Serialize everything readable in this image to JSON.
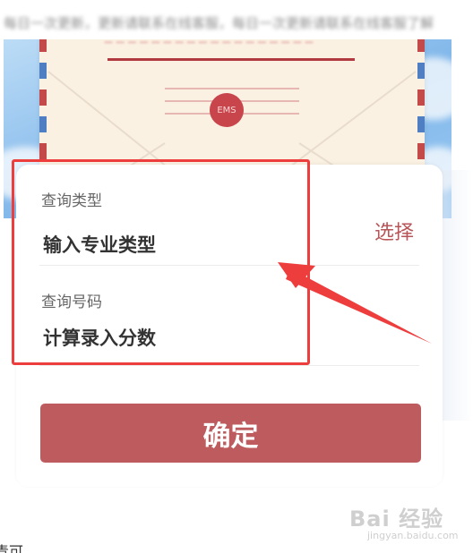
{
  "top_text": "每日一次更新，更新请联系在线客服，每日一次更新请联系在线客服了解",
  "banner": {
    "seal_label": "EMS"
  },
  "form": {
    "query_type_label": "查询类型",
    "query_type_value": "输入专业类型",
    "select_label": "选择",
    "query_number_label": "查询号码",
    "query_number_value": "计算录入分数",
    "confirm_label": "确定"
  },
  "annotation": {
    "highlight_color": "#ee3d3d"
  },
  "footer": {
    "partial_text": "青可"
  },
  "watermark": {
    "brand": "Bai 经验",
    "url": "jingyan.baidu.com"
  },
  "colors": {
    "accent": "#bd5b5e",
    "select_text": "#b85558"
  }
}
